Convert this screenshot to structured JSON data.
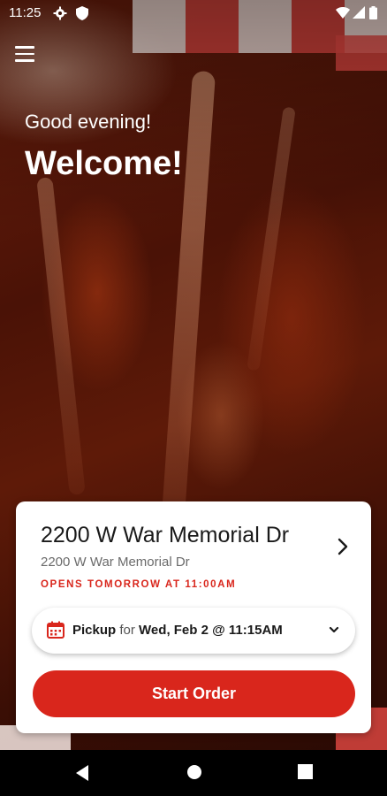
{
  "status_bar": {
    "time": "11:25"
  },
  "hero": {
    "greeting": "Good evening!",
    "welcome": "Welcome!"
  },
  "location": {
    "name": "2200 W War Memorial Dr",
    "address": "2200 W War Memorial Dr",
    "hours_notice": "OPENS TOMORROW AT 11:00AM"
  },
  "pickup": {
    "mode": "Pickup",
    "connector": "for",
    "datetime": "Wed, Feb 2 @ 11:15AM"
  },
  "actions": {
    "start_order": "Start Order"
  },
  "colors": {
    "accent": "#d9261c",
    "text": "#1a1a1a",
    "muted": "#6b6b6b"
  }
}
